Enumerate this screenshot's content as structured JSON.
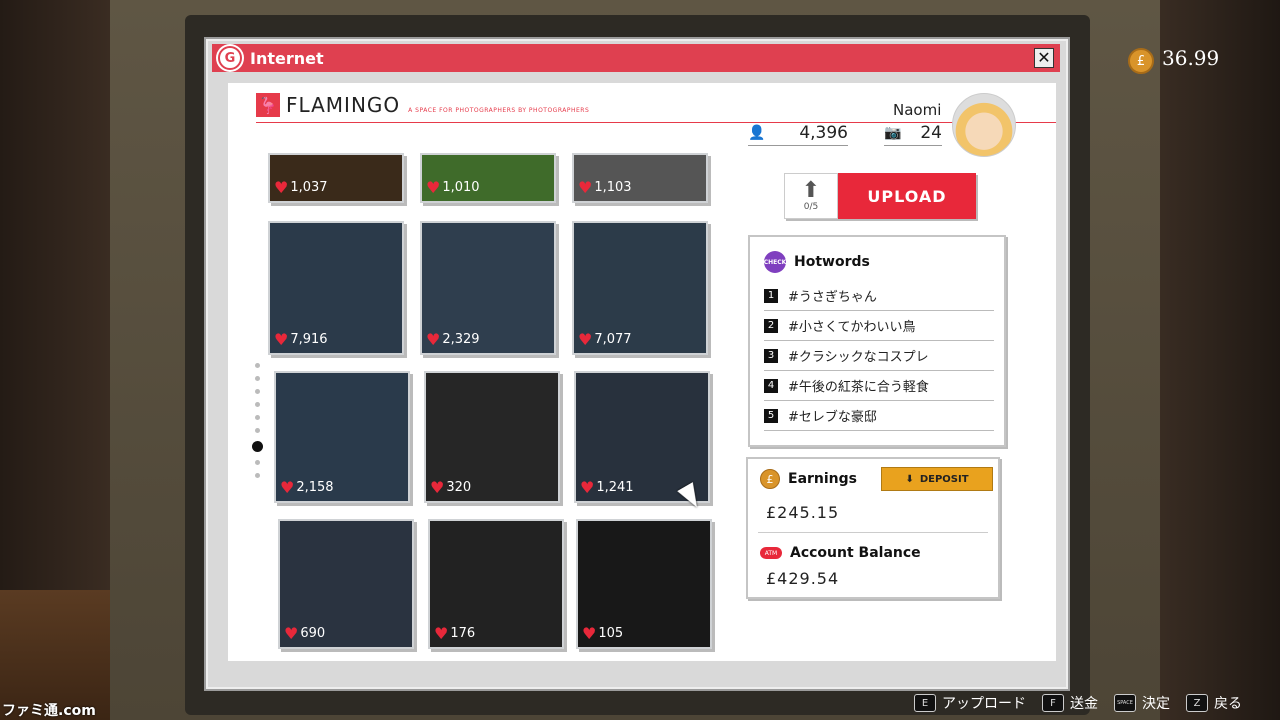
{
  "window": {
    "title": "Internet",
    "close_glyph": "✕"
  },
  "site": {
    "name": "FLAMINGO",
    "tagline": "A SPACE FOR PHOTOGRAPHERS BY PHOTOGRAPHERS",
    "logo_icon": "flamingo-icon"
  },
  "profile": {
    "username": "Naomi",
    "followers": "4,396",
    "photos": "24"
  },
  "photos": [
    {
      "likes": "1,037"
    },
    {
      "likes": "1,010"
    },
    {
      "likes": "1,103"
    },
    {
      "likes": "7,916"
    },
    {
      "likes": "2,329"
    },
    {
      "likes": "7,077"
    },
    {
      "likes": "2,158"
    },
    {
      "likes": "320"
    },
    {
      "likes": "1,241"
    },
    {
      "likes": "690"
    },
    {
      "likes": "176"
    },
    {
      "likes": "105"
    }
  ],
  "upload": {
    "count": "0/5",
    "label": "UPLOAD"
  },
  "hotwords": {
    "title": "Hotwords",
    "badge": "CHECK",
    "items": [
      {
        "rank": "1",
        "text": "#うさぎちゃん"
      },
      {
        "rank": "2",
        "text": "#小さくてかわいい鳥"
      },
      {
        "rank": "3",
        "text": "#クラシックなコスプレ"
      },
      {
        "rank": "4",
        "text": "#午後の紅茶に合う軽食"
      },
      {
        "rank": "5",
        "text": "#セレブな豪邸"
      }
    ]
  },
  "finance": {
    "earnings_label": "Earnings",
    "deposit_label": "DEPOSIT",
    "earnings_value": "£245.15",
    "account_label": "Account Balance",
    "atm_badge": "ATM",
    "account_value": "£429.54"
  },
  "hud": {
    "currency_symbol": "£",
    "money": "36.99"
  },
  "controls": [
    {
      "key": "E",
      "label": "アップロード"
    },
    {
      "key": "F",
      "label": "送金"
    },
    {
      "key": "SPACE",
      "label": "決定"
    },
    {
      "key": "Z",
      "label": "戻る"
    }
  ],
  "watermark": "ファミ通.com",
  "colors": {
    "accent": "#e8283a",
    "titlebar": "#df4050",
    "deposit": "#e9a21e"
  }
}
